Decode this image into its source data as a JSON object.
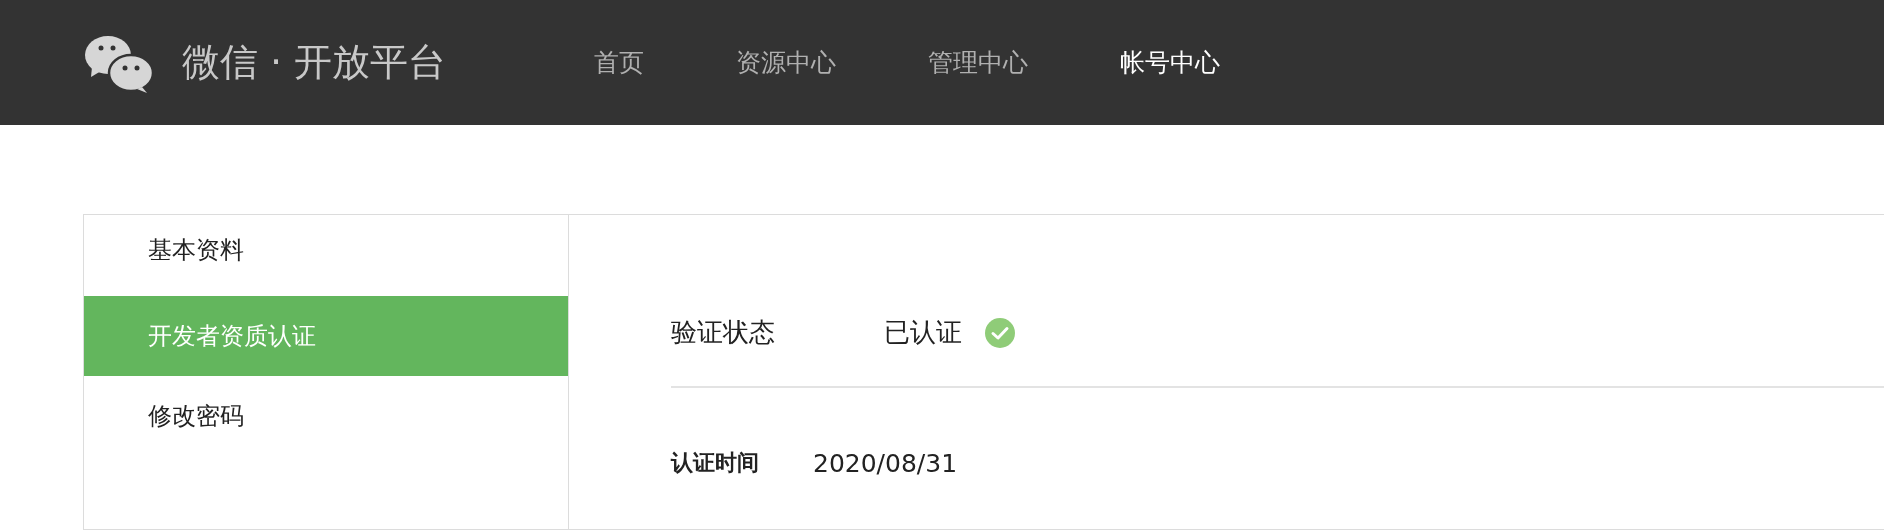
{
  "header": {
    "brand": "微信 · 开放平台",
    "nav": [
      {
        "label": "首页",
        "selected": false
      },
      {
        "label": "资源中心",
        "selected": false
      },
      {
        "label": "管理中心",
        "selected": false
      },
      {
        "label": "帐号中心",
        "selected": true
      }
    ]
  },
  "sidebar": {
    "items": [
      {
        "label": "基本资料",
        "selected": false
      },
      {
        "label": "开发者资质认证",
        "selected": true
      },
      {
        "label": "修改密码",
        "selected": false
      }
    ]
  },
  "verification": {
    "label": "验证状态",
    "value": "已认证",
    "verified": true
  },
  "cert_time": {
    "label": "认证时间",
    "value": "2020/08/31"
  }
}
